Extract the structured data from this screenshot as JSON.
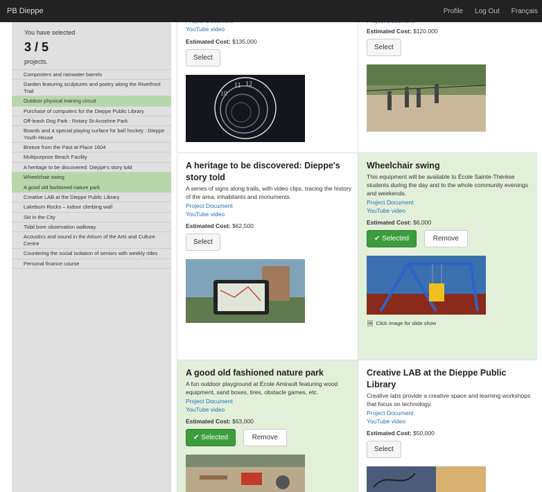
{
  "navbar": {
    "brand": "PB Dieppe",
    "links": [
      "Profile",
      "Log Out",
      "Français"
    ]
  },
  "sidebar": {
    "selected_label": "You have selected",
    "count": "3 / 5",
    "projects_label": "projects.",
    "items": [
      {
        "label": "Composters and rainwater barrels",
        "selected": false
      },
      {
        "label": "Garden featuring sculptures and poetry along the Riverfront Trail",
        "selected": false
      },
      {
        "label": "Outdoor physical training circuit",
        "selected": true
      },
      {
        "label": "Purchase of computers for the Dieppe Public Library",
        "selected": false
      },
      {
        "label": "Off-leash Dog Park : Rotary St-Anselme Park",
        "selected": false
      },
      {
        "label": "Boards and a special playing surface for ball hockey : Dieppe Youth House",
        "selected": false
      },
      {
        "label": "Breeze from the Past at Place 1604",
        "selected": false
      },
      {
        "label": "Multipurpose Beach Facility",
        "selected": false
      },
      {
        "label": "A heritage to be discovered: Dieppe's story told",
        "selected": false
      },
      {
        "label": "Wheelchair swing",
        "selected": true
      },
      {
        "label": "A good old fashioned nature park",
        "selected": true
      },
      {
        "label": "Creative LAB at the Dieppe Public Library",
        "selected": false
      },
      {
        "label": "Lakeburn Rocks – indoor climbing wall",
        "selected": false
      },
      {
        "label": "Ski in the City",
        "selected": false
      },
      {
        "label": "Tidal bore observation walkway",
        "selected": false
      },
      {
        "label": "Acoustics and sound in the Atrium of the Arts and Culture Centre",
        "selected": false
      },
      {
        "label": "Countering the social isolation of seniors with weekly rides",
        "selected": false
      },
      {
        "label": "Personal finance course",
        "selected": false
      }
    ]
  },
  "labels": {
    "project_document": "Project Document",
    "youtube_video": "YouTube video",
    "estimated_cost": "Estimated Cost:",
    "select": "Select",
    "selected": "Selected",
    "remove": "Remove",
    "slideshow": "Click image for slide show"
  },
  "cards": {
    "c1": {
      "cost": "$135,000"
    },
    "c2": {
      "cost": "$120,000"
    },
    "c3": {
      "title": "A heritage to be discovered: Dieppe's story told",
      "desc": "A series of signs along trails, with video clips, tracing the history of the area, inhabitants and monuments.",
      "cost": "$62,500"
    },
    "c4": {
      "title": "Wheelchair swing",
      "desc": "This equipment will be available to École Sainte-Thérèse students during the day and to the whole community evenings and weekends.",
      "cost": "$6,000"
    },
    "c5": {
      "title": "A good old fashioned nature park",
      "desc": "A fun outdoor playground at École Amirault featuring wood equipment, sand boxes, tires, obstacle games, etc.",
      "cost": "$63,000"
    },
    "c6": {
      "title": "Creative LAB at the Dieppe Public Library",
      "desc": "Creative labs provide a creative space and learning workshops that focus on technology.",
      "cost": "$50,000"
    }
  },
  "colors": {
    "selected_green": "#3c9d3c",
    "selected_bg": "#e2f0d9",
    "sidebar_selected": "#b6d7a8",
    "link": "#2a6ebb"
  }
}
